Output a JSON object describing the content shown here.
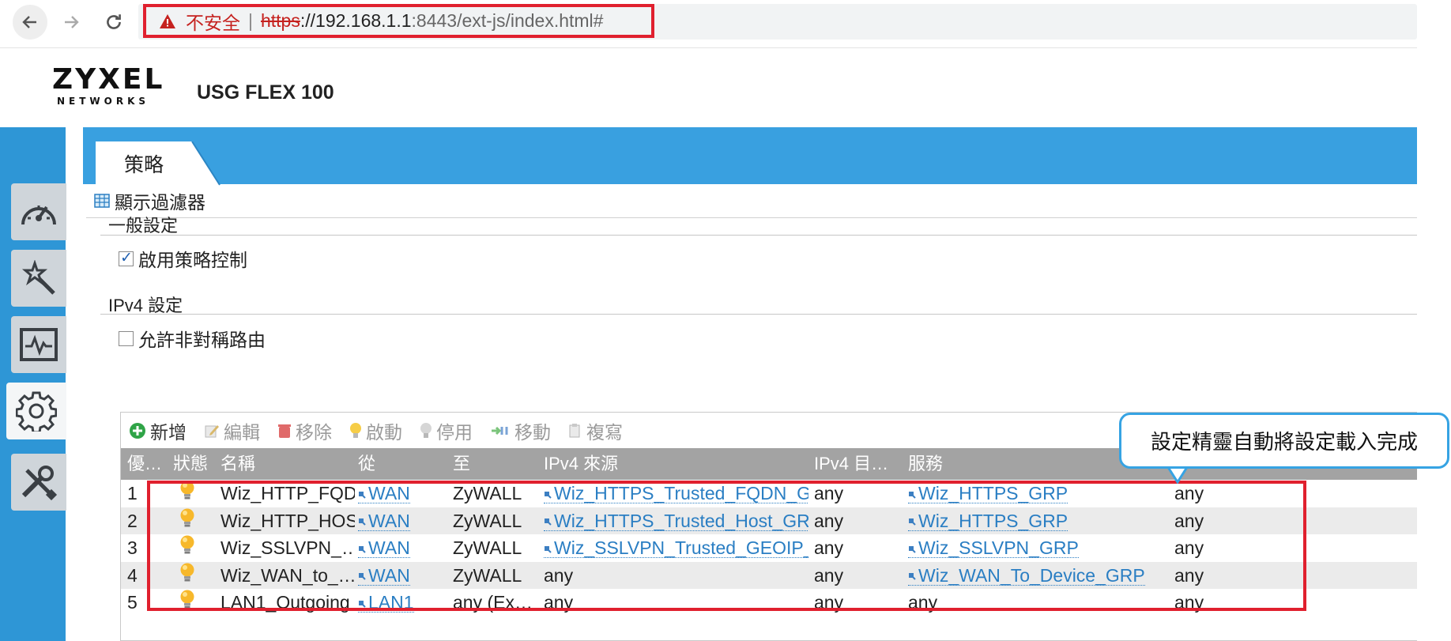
{
  "browser": {
    "insecure_label": "不安全",
    "separator": "|",
    "url_protocol": "https",
    "url_rest": "://192.168.1.1",
    "url_port": ":8443",
    "url_path": "/ext-js/index.html#"
  },
  "header": {
    "logo_main": "ZYXEL",
    "logo_sub": "NETWORKS",
    "model": "USG FLEX 100"
  },
  "nav": {
    "items": [
      {
        "icon": "dashboard-gauge-icon"
      },
      {
        "icon": "wizard-wand-icon"
      },
      {
        "icon": "monitor-pulse-icon"
      },
      {
        "icon": "configuration-gear-icon"
      },
      {
        "icon": "maintenance-tools-icon"
      }
    ],
    "active_index": 3
  },
  "tabs": {
    "active_label": "策略"
  },
  "filter": {
    "label": "顯示過濾器"
  },
  "general": {
    "title": "一般設定",
    "enable_policy_label": "啟用策略控制",
    "enable_policy_checked": true
  },
  "ipv4": {
    "title": "IPv4 設定",
    "asymmetric_label": "允許非對稱路由",
    "asymmetric_checked": false
  },
  "toolbar": {
    "add": "新增",
    "edit": "編輯",
    "remove": "移除",
    "activate": "啟動",
    "deactivate": "停用",
    "move": "移動",
    "clone": "複寫"
  },
  "grid": {
    "columns": [
      "優…",
      "狀態",
      "名稱",
      "從",
      "至",
      "IPv4 來源",
      "IPv4 目…",
      "服務",
      ""
    ],
    "rows": [
      {
        "priority": "1",
        "name": "Wiz_HTTP_FQD…",
        "from": "WAN",
        "to": "ZyWALL",
        "src": "Wiz_HTTPS_Trusted_FQDN_GRP",
        "dst": "any",
        "service": "Wiz_HTTPS_GRP",
        "last": "any"
      },
      {
        "priority": "2",
        "name": "Wiz_HTTP_HOS…",
        "from": "WAN",
        "to": "ZyWALL",
        "src": "Wiz_HTTPS_Trusted_Host_GRP",
        "dst": "any",
        "service": "Wiz_HTTPS_GRP",
        "last": "any"
      },
      {
        "priority": "3",
        "name": "Wiz_SSLVPN_…",
        "from": "WAN",
        "to": "ZyWALL",
        "src": "Wiz_SSLVPN_Trusted_GEOIP_GRP",
        "dst": "any",
        "service": "Wiz_SSLVPN_GRP",
        "last": "any"
      },
      {
        "priority": "4",
        "name": "Wiz_WAN_to_…",
        "from": "WAN",
        "to": "ZyWALL",
        "src": "any",
        "dst": "any",
        "service": "Wiz_WAN_To_Device_GRP",
        "last": "any"
      },
      {
        "priority": "5",
        "name": "LAN1_Outgoing",
        "from": "LAN1",
        "to": "any (Ex…",
        "src": "any",
        "dst": "any",
        "service": "any",
        "last": "any"
      }
    ]
  },
  "callout": {
    "text": "設定精靈自動將設定載入完成"
  },
  "colors": {
    "accent_blue": "#39a0e0",
    "annotation_red": "#e0202e",
    "link_blue": "#2a7ec3"
  }
}
